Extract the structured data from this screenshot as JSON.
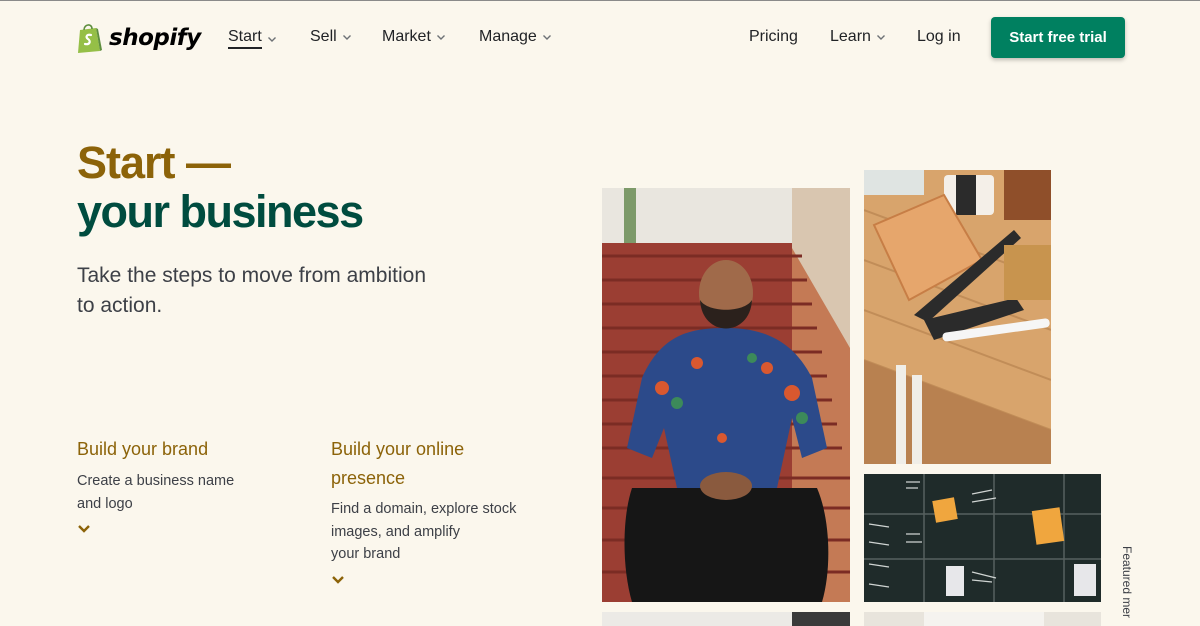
{
  "header": {
    "logo_text": "shopify",
    "nav": [
      {
        "label": "Start"
      },
      {
        "label": "Sell"
      },
      {
        "label": "Market"
      },
      {
        "label": "Manage"
      }
    ],
    "pricing": "Pricing",
    "learn": "Learn",
    "login": "Log in",
    "cta": "Start free trial"
  },
  "hero": {
    "title_line1": "Start —",
    "title_line2": "your business",
    "lead_line1": "Take the steps to move from ambition",
    "lead_line2": "to action."
  },
  "features": [
    {
      "title_lines": [
        "Build your brand"
      ],
      "desc_lines": [
        "Create a business name",
        "and logo"
      ]
    },
    {
      "title_lines": [
        "Build your online",
        "presence"
      ],
      "desc_lines": [
        "Find a domain, explore stock",
        "images, and amplify",
        "your brand"
      ]
    }
  ],
  "featured_label": "Featured mer",
  "colors": {
    "background": "#fbf7ed",
    "brand_green": "#008060",
    "dark_green": "#004c3f",
    "gold": "#8c6309"
  }
}
